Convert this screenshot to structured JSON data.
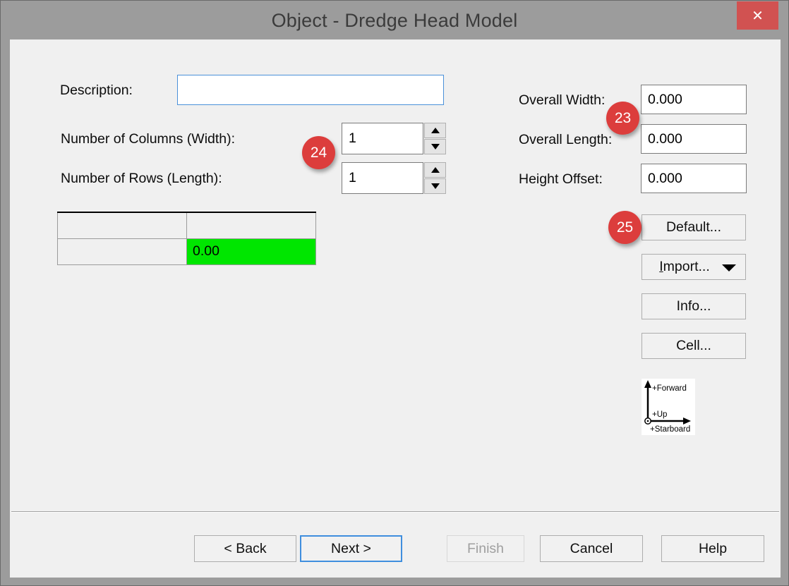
{
  "window": {
    "title": "Object - Dredge Head Model",
    "close_glyph": "✕"
  },
  "form": {
    "description": {
      "label": "Description:",
      "value": ""
    },
    "columns": {
      "label": "Number of Columns (Width):",
      "value": "1"
    },
    "rows": {
      "label": "Number of Rows (Length):",
      "value": "1"
    },
    "overall_width": {
      "label": "Overall Width:",
      "value": "0.000"
    },
    "overall_length": {
      "label": "Overall Length:",
      "value": "0.000"
    },
    "height_offset": {
      "label": "Height Offset:",
      "value": "0.000"
    }
  },
  "grid": {
    "selected_cell_value": "0.00"
  },
  "side_buttons": {
    "default": "Default...",
    "import_initial": "I",
    "import_rest": "mport...",
    "info": "Info...",
    "cell": "Cell..."
  },
  "axis_diagram": {
    "forward": "+Forward",
    "up": "+Up",
    "starboard": "+Starboard"
  },
  "wizard_buttons": {
    "back": "< Back",
    "next": "Next >",
    "finish": "Finish",
    "cancel": "Cancel",
    "help": "Help"
  },
  "annotations": {
    "badge23": "23",
    "badge24": "24",
    "badge25": "25"
  },
  "colors": {
    "titlebar": "#9c9c9c",
    "close_button": "#d15251",
    "annotation_badge": "#dc3d3c",
    "selected_cell": "#00e600",
    "default_button_border": "#3f8ede",
    "focused_input_border": "#4a90d9"
  }
}
